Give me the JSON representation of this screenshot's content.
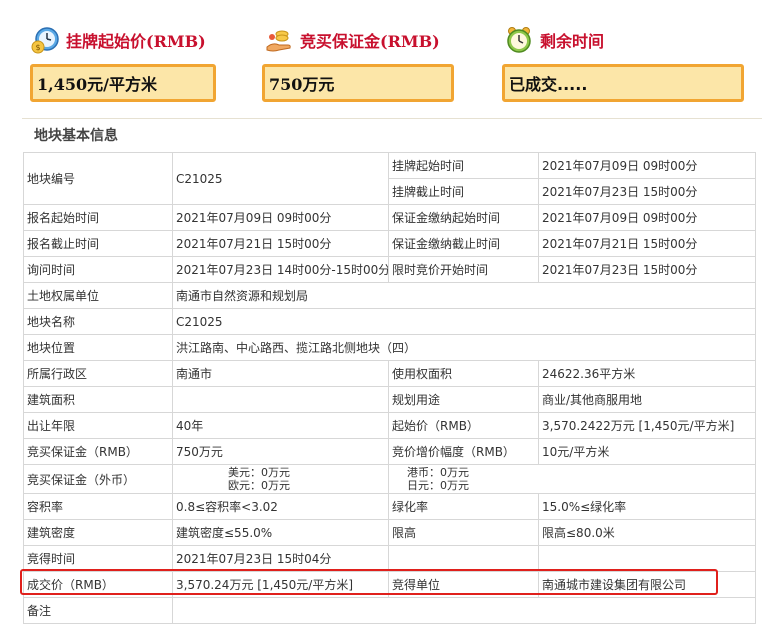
{
  "header": {
    "start_price": {
      "label": "挂牌起始价(RMB)",
      "value": "1,450元/平方米",
      "icon": "money-clock-icon"
    },
    "deposit": {
      "label": "竞买保证金(RMB)",
      "value": "750万元",
      "icon": "coins-hand-icon"
    },
    "remaining": {
      "label": "剩余时间",
      "value": "已成交.....",
      "icon": "alarm-clock-icon"
    }
  },
  "section_title": "地块基本信息",
  "table": {
    "r1": {
      "l1": "地块编号",
      "v1": "C21025",
      "l2a": "挂牌起始时间",
      "v2a": "2021年07月09日 09时00分",
      "l2b": "挂牌截止时间",
      "v2b": "2021年07月23日 15时00分"
    },
    "r2": {
      "l1": "报名起始时间",
      "v1": "2021年07月09日 09时00分",
      "l2": "保证金缴纳起始时间",
      "v2": "2021年07月09日 09时00分"
    },
    "r3": {
      "l1": "报名截止时间",
      "v1": "2021年07月21日 15时00分",
      "l2": "保证金缴纳截止时间",
      "v2": "2021年07月21日 15时00分"
    },
    "r4": {
      "l1": "询问时间",
      "v1": "2021年07月23日 14时00分-15时00分",
      "l2": "限时竞价开始时间",
      "v2": "2021年07月23日 15时00分"
    },
    "r5": {
      "l1": "土地权属单位",
      "v1": "南通市自然资源和规划局"
    },
    "r6": {
      "l1": "地块名称",
      "v1": "C21025"
    },
    "r7": {
      "l1": "地块位置",
      "v1": "洪江路南、中心路西、揽江路北侧地块（四）"
    },
    "r8": {
      "l1": "所属行政区",
      "v1": "南通市",
      "l2": "使用权面积",
      "v2": "24622.36平方米"
    },
    "r9": {
      "l1": "建筑面积",
      "v1": "",
      "l2": "规划用途",
      "v2": "商业/其他商服用地"
    },
    "r10": {
      "l1": "出让年限",
      "v1": "40年",
      "l2": "起始价（RMB）",
      "v2": "3,570.2422万元 [1,450元/平方米]"
    },
    "r11": {
      "l1": "竞买保证金（RMB）",
      "v1": "750万元",
      "l2": "竞价增价幅度（RMB）",
      "v2": "10元/平方米"
    },
    "r12": {
      "l1": "竞买保证金（外币）",
      "usd": "美元：0万元",
      "eur": "欧元：0万元",
      "hkd": "港币：0万元",
      "jpy": "日元：0万元"
    },
    "r13": {
      "l1": "容积率",
      "v1": "0.8≤容积率<3.02",
      "l2": "绿化率",
      "v2": "15.0%≤绿化率"
    },
    "r14": {
      "l1": "建筑密度",
      "v1": "建筑密度≤55.0%",
      "l2": "限高",
      "v2": "限高≤80.0米"
    },
    "r15": {
      "l1": "竞得时间",
      "v1": "2021年07月23日 15时04分",
      "l2": "",
      "v2": ""
    },
    "r16": {
      "l1": "成交价（RMB）",
      "v1": "3,570.24万元 [1,450元/平方米]",
      "l2": "竞得单位",
      "v2": "南通城市建设集团有限公司"
    },
    "r17": {
      "l1": "备注",
      "v1": ""
    }
  }
}
